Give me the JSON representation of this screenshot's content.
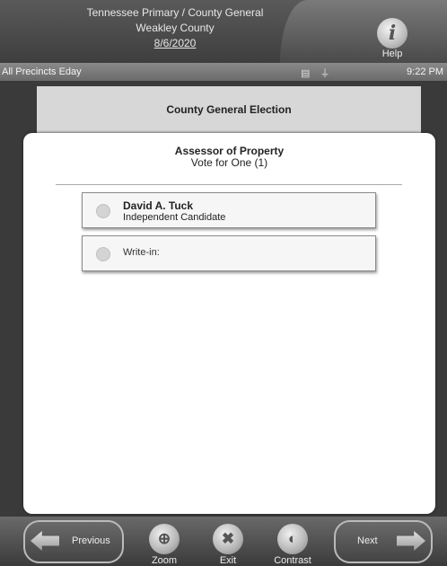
{
  "header": {
    "line1": "Tennessee Primary / County General",
    "line2": "Weakley County",
    "date": "8/6/2020",
    "help_label": "Help"
  },
  "status": {
    "left": "All Precincts Eday",
    "time": "9:22 PM"
  },
  "contest_header": "County General Election",
  "ballot": {
    "office": "Assessor of Property",
    "instruction": "Vote for One (1)",
    "candidates": [
      {
        "name": "David A. Tuck",
        "party": "Independent Candidate"
      }
    ],
    "writein_label": "Write-in:"
  },
  "footer": {
    "previous": "Previous",
    "next": "Next",
    "zoom": "Zoom",
    "exit": "Exit",
    "contrast": "Contrast"
  }
}
